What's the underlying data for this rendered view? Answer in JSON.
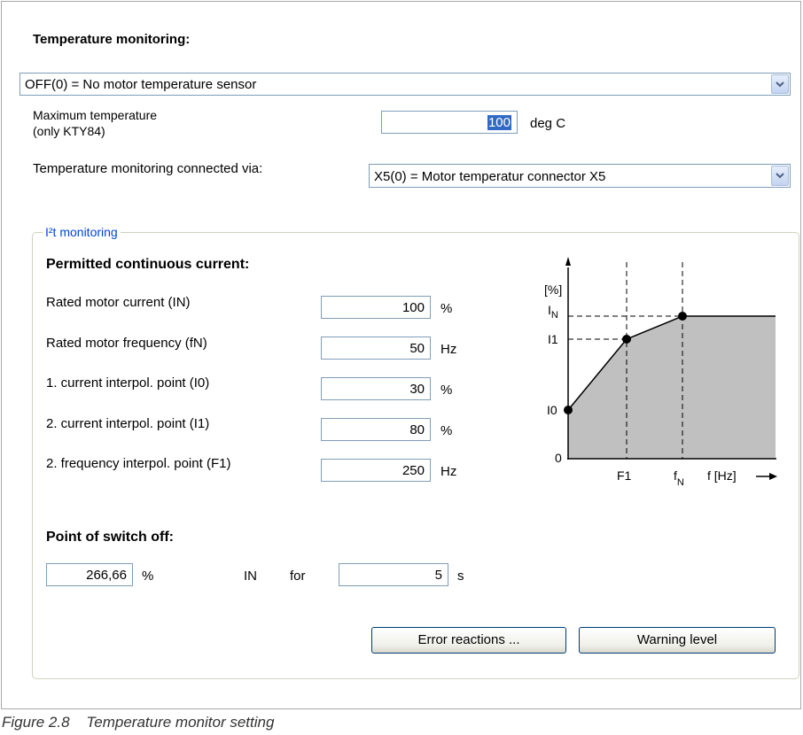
{
  "temp_monitoring": {
    "heading": "Temperature monitoring:",
    "sensor_select": "OFF(0) = No motor temperature sensor",
    "max_temp_label_line1": "Maximum temperature",
    "max_temp_label_line2": "(only KTY84)",
    "max_temp_value": "100",
    "max_temp_unit": "deg C",
    "connected_via_label": "Temperature monitoring connected via:",
    "connected_via_select": "X5(0) = Motor temperatur connector X5"
  },
  "i2t": {
    "group_title": "I²t monitoring",
    "permitted_heading": "Permitted continuous current:",
    "rows": [
      {
        "label": "Rated motor current (IN)",
        "value": "100",
        "unit": "%"
      },
      {
        "label": "Rated motor frequency (fN)",
        "value": "50",
        "unit": "Hz"
      },
      {
        "label": "1. current interpol. point (I0)",
        "value": "30",
        "unit": "%"
      },
      {
        "label": "2. current interpol. point (I1)",
        "value": "80",
        "unit": "%"
      },
      {
        "label": "2. frequency interpol. point (F1)",
        "value": "250",
        "unit": "Hz"
      }
    ],
    "switch_off_heading": "Point of switch off:",
    "switch_off_value": "266,66",
    "switch_off_unit": "%",
    "switch_off_ref": "IN",
    "for_label": "for",
    "duration_value": "5",
    "duration_unit": "s",
    "error_button": "Error reactions ...",
    "warning_button": "Warning level"
  },
  "diagram": {
    "y_unit": "[%]",
    "label_in": "I",
    "label_in_sub": "N",
    "label_i1": "I1",
    "label_i0": "I0",
    "label_zero": "0",
    "label_f1": "F1",
    "label_fn": "f",
    "label_fn_sub": "N",
    "x_axis": "f [Hz]"
  },
  "caption": "Figure 2.8    Temperature monitor setting",
  "colors": {
    "area_fill": "#c0c0c0",
    "group_title": "#0046d5",
    "input_border": "#7f9db9"
  }
}
